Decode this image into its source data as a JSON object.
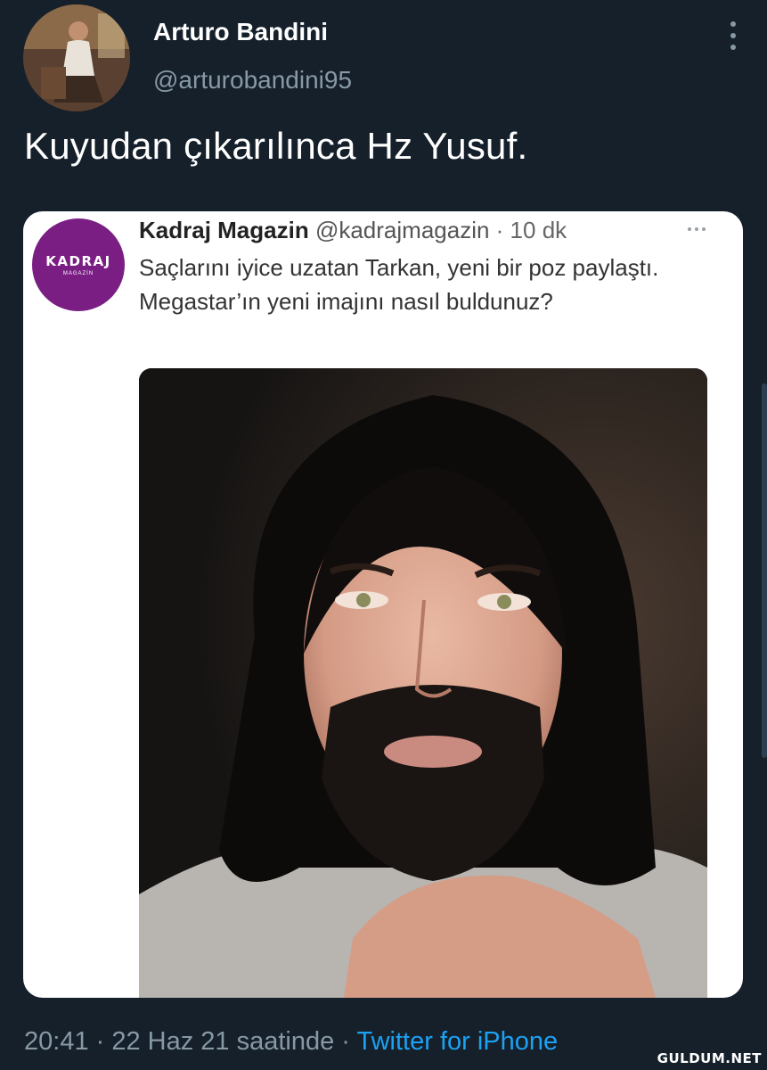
{
  "tweet": {
    "author_name": "Arturo Bandini",
    "author_handle": "@arturobandini95",
    "text": "Kuyudan çıkarılınca Hz Yusuf.",
    "timestamp": "20:41 · 22 Haz 21 saatinde · ",
    "source": "Twitter for iPhone",
    "more_icon": "more-vertical-icon"
  },
  "embedded": {
    "account_name": "Kadraj Magazin",
    "account_handle": "@kadrajmagazin",
    "time": "· 10 dk",
    "logo_text": "KADRAJ",
    "logo_subtext": "MAGAZİN",
    "text": "Saçlarını iyice uzatan Tarkan, yeni bir poz paylaştı. Megastar’ın yeni imajını nasıl buldunuz?",
    "more_icon": "more-horizontal-icon"
  },
  "watermark": "GULDUM.NET",
  "colors": {
    "background": "#15202b",
    "secondary_text": "#8899a6",
    "link": "#1da1f2",
    "logo_purple": "#7a1e84"
  }
}
